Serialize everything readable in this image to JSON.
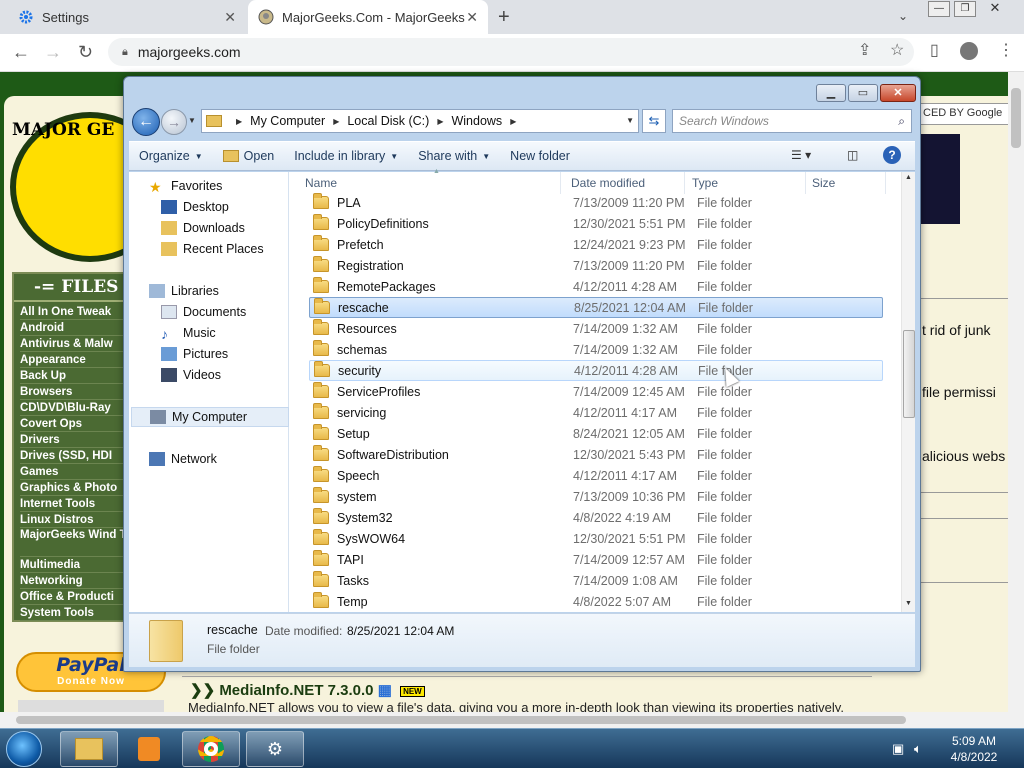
{
  "browser": {
    "tabs": [
      {
        "title": "Settings",
        "active": false,
        "icon": "gear-icon"
      },
      {
        "title": "MajorGeeks.Com - MajorGeeks",
        "active": true,
        "icon": "majorgeeks-favicon"
      }
    ],
    "url": "majorgeeks.com"
  },
  "site": {
    "logo_text": "MAJOR GE",
    "files_heading": "-= FILES",
    "categories": [
      "All In One Tweak",
      "Android",
      "Antivirus & Malw",
      "Appearance",
      "Back Up",
      "Browsers",
      "CD\\DVD\\Blu-Ray",
      "Covert Ops",
      "Drivers",
      "Drives (SSD, HDI",
      "Games",
      "Graphics & Photo",
      "Internet Tools",
      "Linux Distros",
      "MajorGeeks Wind Tweaks",
      "Multimedia",
      "Networking",
      "Office & Producti",
      "System Tools"
    ],
    "paypal_text": "PayPal",
    "paypal_donate": "Donate Now",
    "google_label": "CED BY Google",
    "snippets": [
      "t rid of junk",
      "file permissi",
      "alicious webs"
    ],
    "article_title": "MediaInfo.NET 7.3.0.0",
    "article_badge": "NEW",
    "article_body": "MediaInfo.NET allows you to view a file's data, giving you a more in-depth look than viewing its properties natively."
  },
  "explorer": {
    "breadcrumb": [
      "My Computer",
      "Local Disk (C:)",
      "Windows"
    ],
    "search_placeholder": "Search Windows",
    "commands": {
      "organize": "Organize",
      "open": "Open",
      "include": "Include in library",
      "share": "Share with",
      "newfolder": "New folder"
    },
    "nav": {
      "favorites": "Favorites",
      "desktop": "Desktop",
      "downloads": "Downloads",
      "recent": "Recent Places",
      "libraries": "Libraries",
      "documents": "Documents",
      "music": "Music",
      "pictures": "Pictures",
      "videos": "Videos",
      "mycomputer": "My Computer",
      "network": "Network"
    },
    "columns": {
      "name": "Name",
      "date": "Date modified",
      "type": "Type",
      "size": "Size"
    },
    "files": [
      {
        "name": "PLA",
        "date": "7/13/2009 11:20 PM",
        "type": "File folder"
      },
      {
        "name": "PolicyDefinitions",
        "date": "12/30/2021 5:51 PM",
        "type": "File folder"
      },
      {
        "name": "Prefetch",
        "date": "12/24/2021 9:23 PM",
        "type": "File folder"
      },
      {
        "name": "Registration",
        "date": "7/13/2009 11:20 PM",
        "type": "File folder"
      },
      {
        "name": "RemotePackages",
        "date": "4/12/2011 4:28 AM",
        "type": "File folder"
      },
      {
        "name": "rescache",
        "date": "8/25/2021 12:04 AM",
        "type": "File folder"
      },
      {
        "name": "Resources",
        "date": "7/14/2009 1:32 AM",
        "type": "File folder"
      },
      {
        "name": "schemas",
        "date": "7/14/2009 1:32 AM",
        "type": "File folder"
      },
      {
        "name": "security",
        "date": "4/12/2011 4:28 AM",
        "type": "File folder"
      },
      {
        "name": "ServiceProfiles",
        "date": "7/14/2009 12:45 AM",
        "type": "File folder"
      },
      {
        "name": "servicing",
        "date": "4/12/2011 4:17 AM",
        "type": "File folder"
      },
      {
        "name": "Setup",
        "date": "8/24/2021 12:05 AM",
        "type": "File folder"
      },
      {
        "name": "SoftwareDistribution",
        "date": "12/30/2021 5:43 PM",
        "type": "File folder"
      },
      {
        "name": "Speech",
        "date": "4/12/2011 4:17 AM",
        "type": "File folder"
      },
      {
        "name": "system",
        "date": "7/13/2009 10:36 PM",
        "type": "File folder"
      },
      {
        "name": "System32",
        "date": "4/8/2022 4:19 AM",
        "type": "File folder"
      },
      {
        "name": "SysWOW64",
        "date": "12/30/2021 5:51 PM",
        "type": "File folder"
      },
      {
        "name": "TAPI",
        "date": "7/14/2009 12:57 AM",
        "type": "File folder"
      },
      {
        "name": "Tasks",
        "date": "7/14/2009 1:08 AM",
        "type": "File folder"
      },
      {
        "name": "Temp",
        "date": "4/8/2022 5:07 AM",
        "type": "File folder"
      }
    ],
    "selected_name": "rescache",
    "hover_name": "security",
    "details": {
      "name": "rescache",
      "date_label": "Date modified:",
      "date_value": "8/25/2021 12:04 AM",
      "type": "File folder"
    }
  },
  "taskbar": {
    "time": "5:09 AM",
    "date": "4/8/2022"
  }
}
